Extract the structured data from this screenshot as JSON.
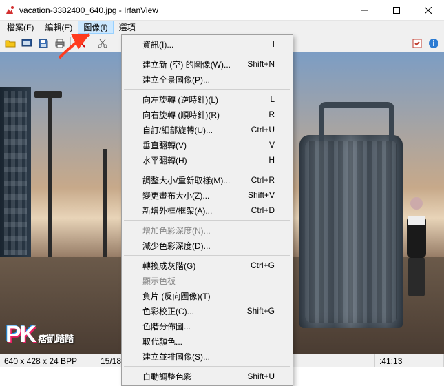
{
  "window": {
    "title": "vacation-3382400_640.jpg - IrfanView"
  },
  "menubar": {
    "items": [
      {
        "label": "檔案(F)"
      },
      {
        "label": "編輯(E)"
      },
      {
        "label": "圖像(I)"
      },
      {
        "label": "選項"
      }
    ]
  },
  "watermark": {
    "logo": "PK",
    "text": "痞凱踏踏"
  },
  "truetext": "TRUE",
  "status": {
    "dims": "640 x 428 x 24 BPP",
    "index": "15/18",
    "time": ":41:13"
  },
  "dropdown": [
    {
      "type": "item",
      "label": "資訊(I)...",
      "shortcut": "I"
    },
    {
      "type": "sep"
    },
    {
      "type": "item",
      "label": "建立新 (空) 的圖像(W)...",
      "shortcut": "Shift+N"
    },
    {
      "type": "item",
      "label": "建立全景圖像(P)..."
    },
    {
      "type": "sep"
    },
    {
      "type": "item",
      "label": "向左旋轉 (逆時針)(L)",
      "shortcut": "L"
    },
    {
      "type": "item",
      "label": "向右旋轉 (順時針)(R)",
      "shortcut": "R"
    },
    {
      "type": "item",
      "label": "自訂/細部旋轉(U)...",
      "shortcut": "Ctrl+U"
    },
    {
      "type": "item",
      "label": "垂直翻轉(V)",
      "shortcut": "V"
    },
    {
      "type": "item",
      "label": "水平翻轉(H)",
      "shortcut": "H"
    },
    {
      "type": "sep"
    },
    {
      "type": "item",
      "label": "調整大小/重新取樣(M)...",
      "shortcut": "Ctrl+R"
    },
    {
      "type": "item",
      "label": "變更畫布大小(Z)...",
      "shortcut": "Shift+V"
    },
    {
      "type": "item",
      "label": "新增外框/框架(A)...",
      "shortcut": "Ctrl+D"
    },
    {
      "type": "sep"
    },
    {
      "type": "item",
      "label": "增加色彩深度(N)...",
      "disabled": true
    },
    {
      "type": "item",
      "label": "減少色彩深度(D)..."
    },
    {
      "type": "sep"
    },
    {
      "type": "item",
      "label": "轉換成灰階(G)",
      "shortcut": "Ctrl+G"
    },
    {
      "type": "item",
      "label": "顯示色板",
      "disabled": true
    },
    {
      "type": "item",
      "label": "負片 (反向圖像)(T)"
    },
    {
      "type": "item",
      "label": "色彩校正(C)...",
      "shortcut": "Shift+G"
    },
    {
      "type": "item",
      "label": "色階分佈圖..."
    },
    {
      "type": "item",
      "label": "取代顏色..."
    },
    {
      "type": "item",
      "label": "建立並排圖像(S)..."
    },
    {
      "type": "sep"
    },
    {
      "type": "item",
      "label": "自動調整色彩",
      "shortcut": "Shift+U"
    }
  ]
}
